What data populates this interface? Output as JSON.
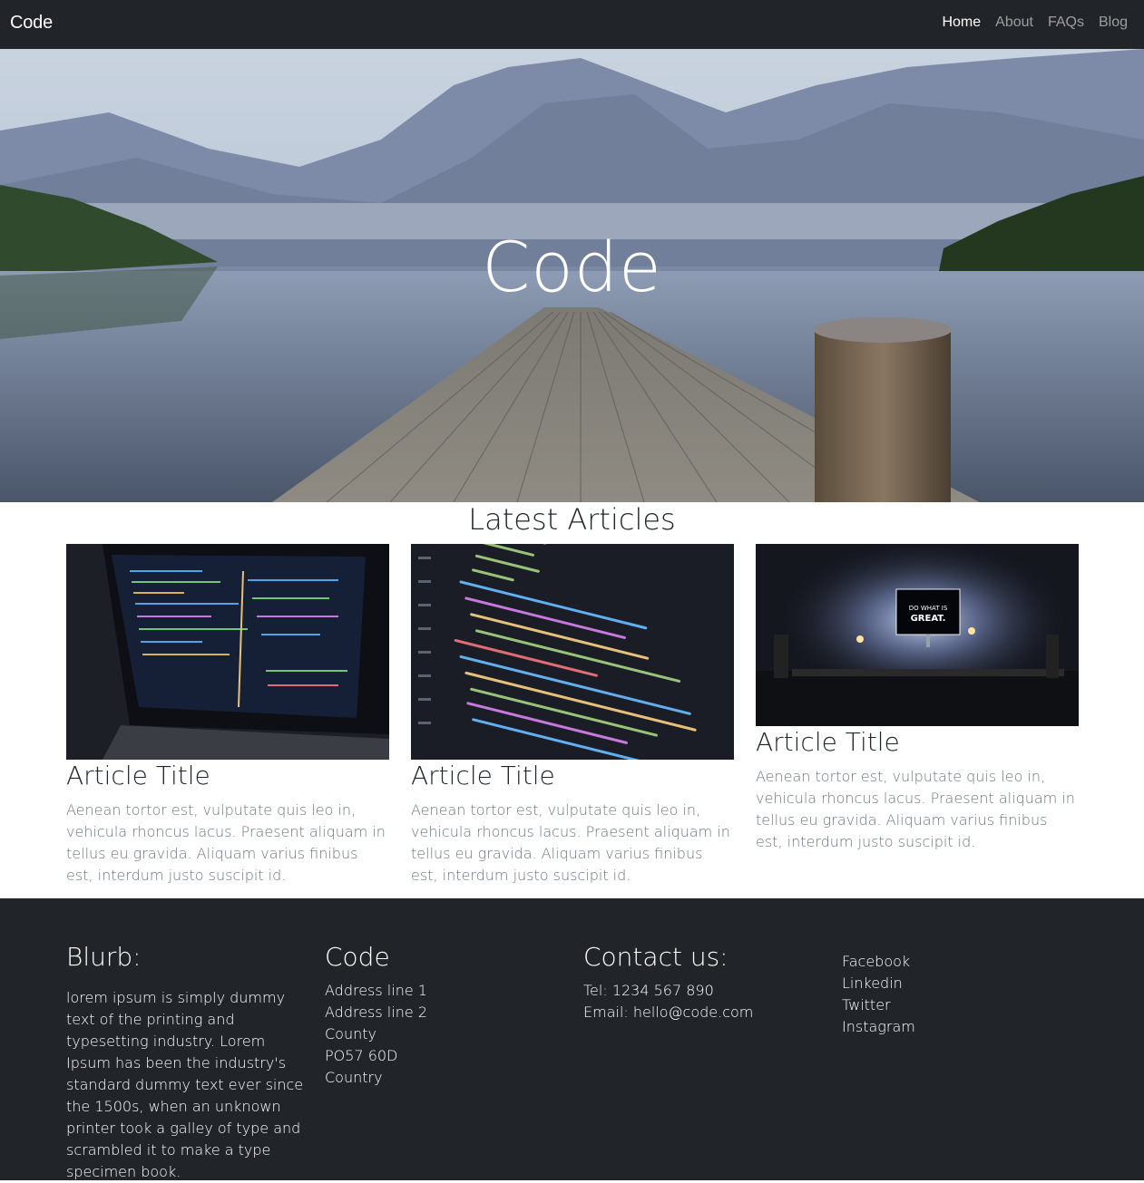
{
  "navbar": {
    "brand": "Code",
    "links": [
      {
        "label": "Home",
        "active": true
      },
      {
        "label": "About",
        "active": false
      },
      {
        "label": "FAQs",
        "active": false
      },
      {
        "label": "Blog",
        "active": false
      }
    ]
  },
  "hero": {
    "title": "Code"
  },
  "articles": {
    "heading": "Latest Articles",
    "items": [
      {
        "title": "Article Title",
        "text": "Aenean tortor est, vulputate quis leo in, vehicula rhoncus lacus. Praesent aliquam in tellus eu gravida. Aliquam varius finibus est, interdum justo suscipit id."
      },
      {
        "title": "Article Title",
        "text": "Aenean tortor est, vulputate quis leo in, vehicula rhoncus lacus. Praesent aliquam in tellus eu gravida. Aliquam varius finibus est, interdum justo suscipit id."
      },
      {
        "title": "Article Title",
        "text": "Aenean tortor est, vulputate quis leo in, vehicula rhoncus lacus. Praesent aliquam in tellus eu gravida. Aliquam varius finibus est, interdum justo suscipit id."
      }
    ],
    "image3_caption_line1": "DO WHAT IS",
    "image3_caption_line2": "GREAT."
  },
  "footer": {
    "blurb": {
      "heading": "Blurb:",
      "text": "lorem ipsum is simply dummy text of the printing and typesetting industry. Lorem Ipsum has been the industry's standard dummy text ever since the 1500s, when an unknown printer took a galley of type and scrambled it to make a type specimen book."
    },
    "address": {
      "heading": "Code",
      "lines": [
        "Address line 1",
        "Address line 2",
        "County",
        "PO57 60D",
        "Country"
      ]
    },
    "contact": {
      "heading": "Contact us:",
      "tel": "Tel: 1234 567 890",
      "email": "Email: hello@code.com"
    },
    "social": [
      "Facebook",
      "Linkedin",
      "Twitter",
      "Instagram"
    ]
  },
  "colors": {
    "navbar_bg": "#212529",
    "footer_bg": "#212529",
    "muted_text": "#6c757d"
  }
}
